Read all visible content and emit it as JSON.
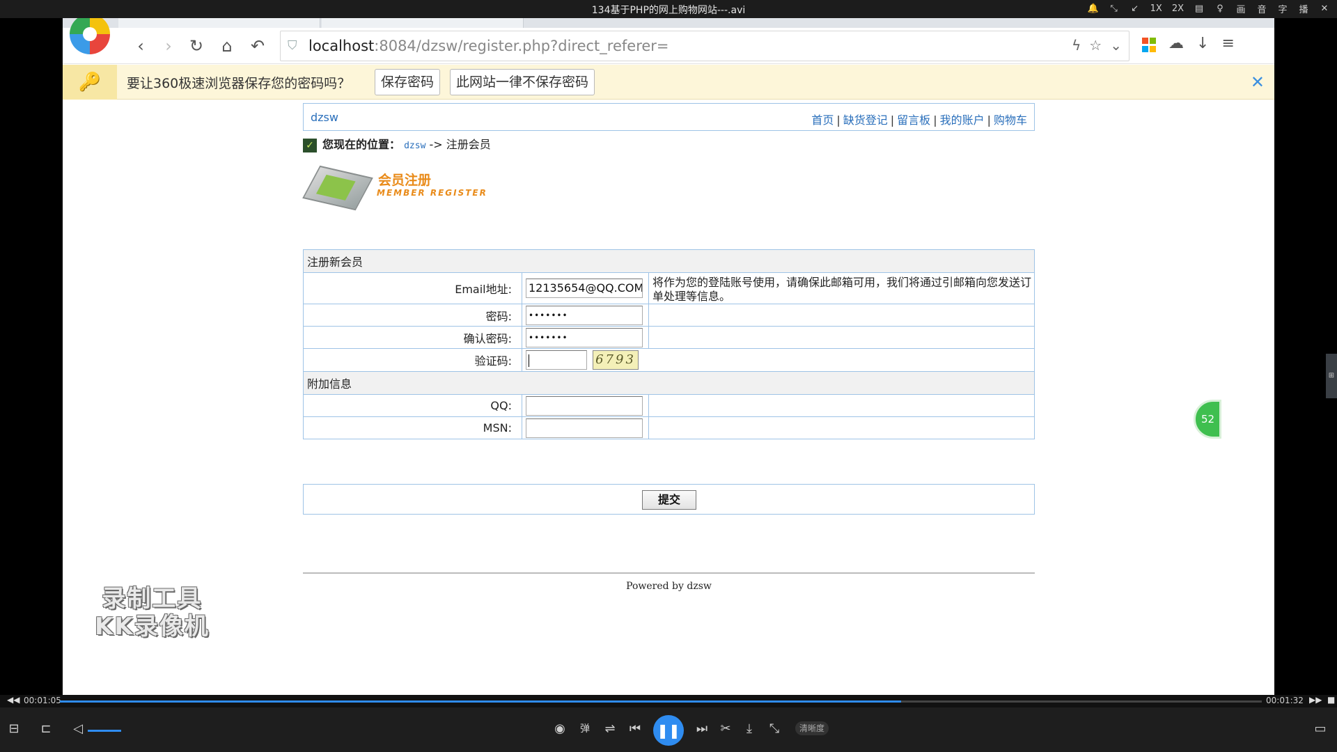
{
  "player": {
    "title": "134基于PHP的网上购物网站---.avi",
    "top_controls": [
      "🔔",
      "⤡",
      "↙",
      "1X",
      "2X",
      "▤",
      "♀",
      "画",
      "音",
      "字",
      "播",
      "✕"
    ],
    "time_current": "00:01:05",
    "time_total": "00:01:32",
    "progress": 0.7,
    "volume": 0.6,
    "quality_label": "清晰度",
    "side_tab_label": "⊞"
  },
  "browser": {
    "url_host": "localhost",
    "url_rest": ":8084/dzsw/register.php?direct_referer=",
    "password_prompt": {
      "text": "要让360极速浏览器保存您的密码吗？",
      "save_label": "保存密码",
      "never_label": "此网站一律不保存密码"
    }
  },
  "site": {
    "name": "dzsw",
    "nav": [
      "首页",
      "缺货登记",
      "留言板",
      "我的账户",
      "购物车"
    ],
    "breadcrumb": {
      "prefix": "您现在的位置：",
      "home": "dzsw",
      "arrow": "->",
      "current": "注册会员"
    },
    "banner": {
      "title": "会员注册",
      "subtitle": "MEMBER REGISTER"
    },
    "form": {
      "section_new": "注册新会员",
      "email_label": "Email地址:",
      "email_value": "12135654@QQ.COM",
      "email_note": "将作为您的登陆账号使用，请确保此邮箱可用，我们将通过引邮箱向您发送订单处理等信息。",
      "password_label": "密码:",
      "password_value": "•••••••",
      "confirm_label": "确认密码:",
      "confirm_value": "•••••••",
      "captcha_label": "验证码:",
      "captcha_image_text": "6793",
      "section_extra": "附加信息",
      "qq_label": "QQ:",
      "msn_label": "MSN:",
      "submit_label": "提交"
    },
    "footer": "Powered by dzsw"
  },
  "float_badge": "52",
  "watermark": [
    "录制工具",
    "KK录像机"
  ],
  "colors": {
    "link": "#2a6fbb",
    "table_border": "#9ec3e6",
    "accent_orange": "#e98b1a",
    "player_blue": "#2f8cf0"
  }
}
